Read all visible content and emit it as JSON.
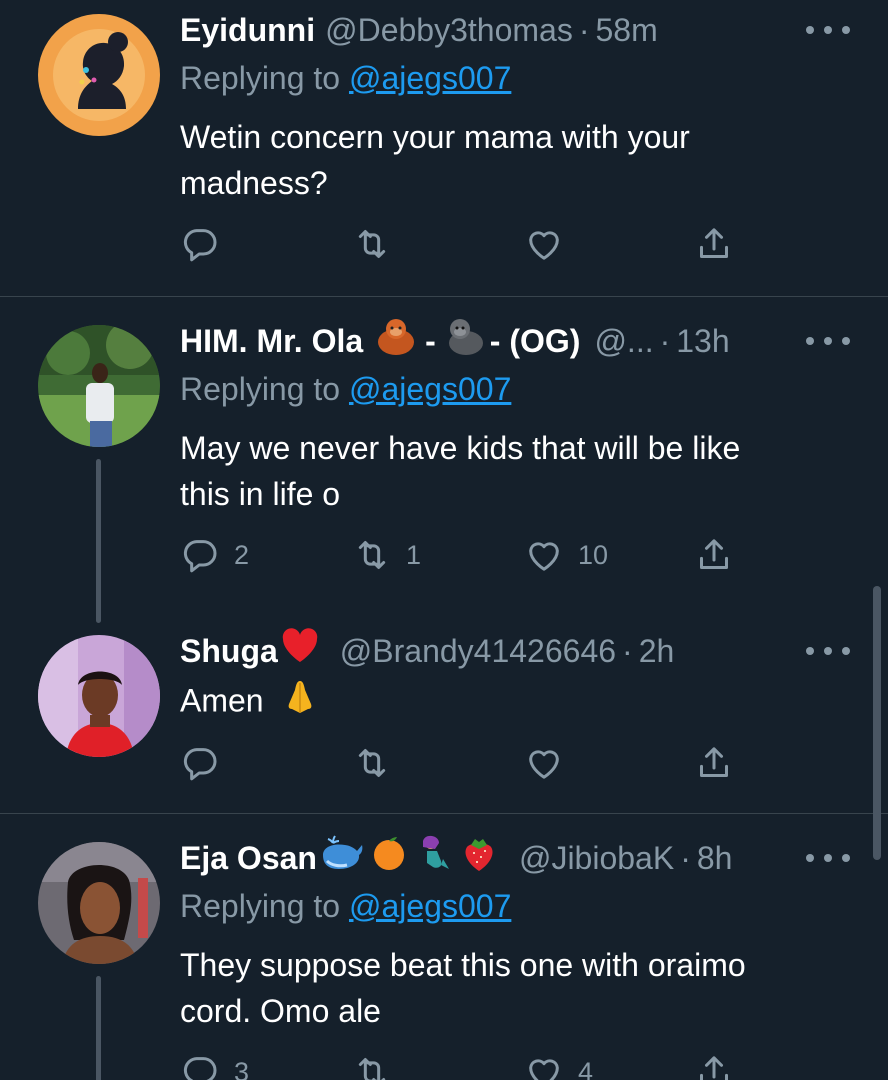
{
  "tweets": [
    {
      "name": "Eyidunni",
      "handle": "@Debby3thomas",
      "time": "58m",
      "replying_label": "Replying to",
      "replying_handle": "@ajegs007",
      "text_line1": "Wetin concern your mama with your",
      "text_line2": "madness?",
      "counts": {
        "reply": "",
        "retweet": "",
        "like": ""
      }
    },
    {
      "name": "HIM. Mr. Ola",
      "name_suffix": "- (OG)",
      "handle": "@...",
      "time": "13h",
      "replying_label": "Replying to",
      "replying_handle": "@ajegs007",
      "text_line1": "May we never have kids that will be like",
      "text_line2": "this in life o",
      "counts": {
        "reply": "2",
        "retweet": "1",
        "like": "10"
      }
    },
    {
      "name": "Shuga",
      "handle": "@Brandy41426646",
      "time": "2h",
      "text_line1": "Amen",
      "counts": {
        "reply": "",
        "retweet": "",
        "like": ""
      }
    },
    {
      "name": "Eja Osan",
      "handle": "@JibiobaK",
      "time": "8h",
      "replying_label": "Replying to",
      "replying_handle": "@ajegs007",
      "text_line1": "They suppose beat this one with oraimo",
      "text_line2": "cord. Omo ale",
      "counts": {
        "reply": "3",
        "retweet": "",
        "like": "4"
      }
    }
  ],
  "separator": "·",
  "icons": [
    "reply-icon",
    "retweet-icon",
    "like-icon",
    "share-icon",
    "more-icon"
  ],
  "colors": {
    "background": "#15202b",
    "text": "#ffffff",
    "muted": "#8899a6",
    "link": "#1d9bf0",
    "divider": "#38444d"
  }
}
